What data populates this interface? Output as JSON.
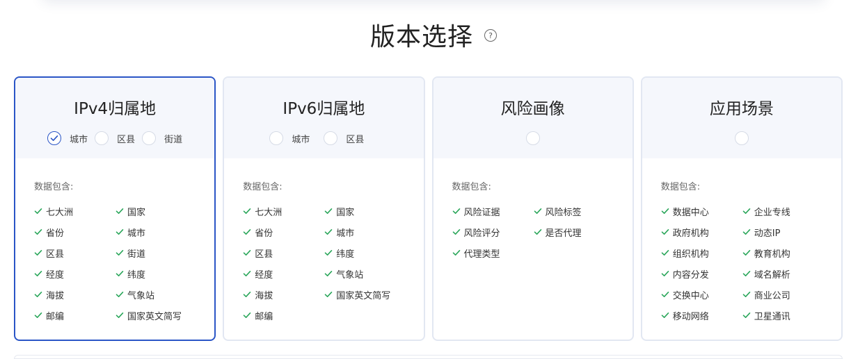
{
  "header": {
    "title": "版本选择",
    "help_icon": "question-circle-icon"
  },
  "accent_color": "#2a55c6",
  "check_color": "#2aa65a",
  "cards": [
    {
      "title": "IPv4归属地",
      "selected": true,
      "options": [
        {
          "label": "城市",
          "checked": true
        },
        {
          "label": "区县",
          "checked": false
        },
        {
          "label": "街道",
          "checked": false
        }
      ],
      "includes_label": "数据包含:",
      "features": [
        "七大洲",
        "国家",
        "省份",
        "城市",
        "区县",
        "街道",
        "经度",
        "纬度",
        "海拔",
        "气象站",
        "邮编",
        "国家英文简写"
      ]
    },
    {
      "title": "IPv6归属地",
      "selected": false,
      "options": [
        {
          "label": "城市",
          "checked": false
        },
        {
          "label": "区县",
          "checked": false
        }
      ],
      "includes_label": "数据包含:",
      "features": [
        "七大洲",
        "国家",
        "省份",
        "城市",
        "区县",
        "纬度",
        "经度",
        "气象站",
        "海拔",
        "国家英文简写",
        "邮编"
      ]
    },
    {
      "title": "风险画像",
      "selected": false,
      "options": [
        {
          "label": "",
          "checked": false
        }
      ],
      "includes_label": "数据包含:",
      "features": [
        "风险证据",
        "风险标签",
        "风险评分",
        "是否代理",
        "代理类型"
      ]
    },
    {
      "title": "应用场景",
      "selected": false,
      "options": [
        {
          "label": "",
          "checked": false
        }
      ],
      "includes_label": "数据包含:",
      "features": [
        "数据中心",
        "企业专线",
        "政府机构",
        "动态IP",
        "组织机构",
        "教育机构",
        "内容分发",
        "域名解析",
        "交换中心",
        "商业公司",
        "移动网络",
        "卫星通讯"
      ]
    }
  ]
}
